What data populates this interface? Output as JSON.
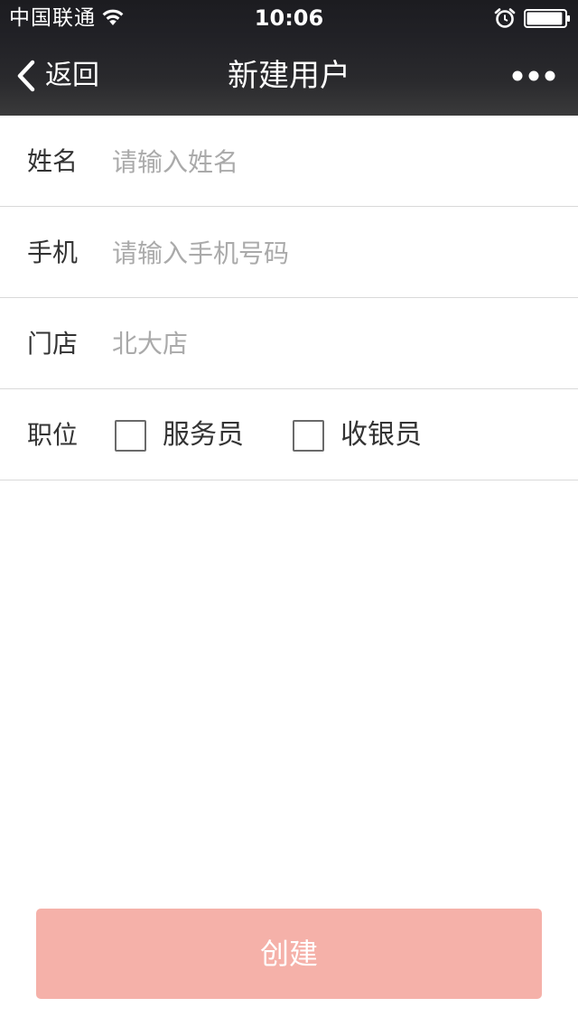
{
  "status_bar": {
    "carrier": "中国联通",
    "time": "10:06",
    "wifi_icon": "wifi-icon",
    "alarm_icon": "alarm-icon",
    "battery_icon": "battery-icon",
    "battery_level": 0.95
  },
  "nav": {
    "back_label": "返回",
    "title": "新建用户",
    "more_icon": "more-dots-icon"
  },
  "form": {
    "name": {
      "label": "姓名",
      "placeholder": "请输入姓名",
      "value": ""
    },
    "phone": {
      "label": "手机",
      "placeholder": "请输入手机号码",
      "value": ""
    },
    "store": {
      "label": "门店",
      "value": "北大店"
    },
    "position": {
      "label": "职位",
      "options": [
        {
          "label": "服务员",
          "checked": false
        },
        {
          "label": "收银员",
          "checked": false
        }
      ]
    }
  },
  "create_button": {
    "label": "创建",
    "color": "#f5b1a9"
  },
  "colors": {
    "nav_background": "#232327",
    "divider": "#d9d9d9",
    "placeholder": "#aaaaaa",
    "label_text": "#333333"
  }
}
